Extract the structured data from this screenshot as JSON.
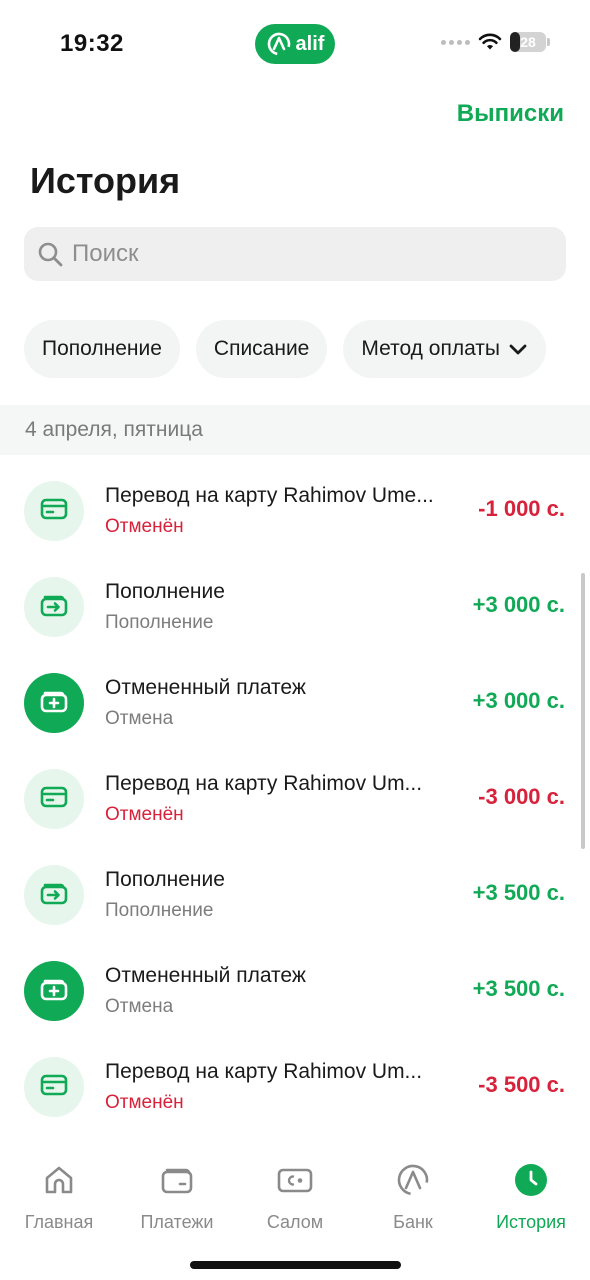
{
  "status_bar": {
    "time": "19:32",
    "brand": "alif",
    "battery": "28",
    "battery_level": 0.28
  },
  "header": {
    "statements_link": "Выписки",
    "title": "История"
  },
  "search": {
    "placeholder": "Поиск"
  },
  "filters": [
    {
      "label": "Пополнение"
    },
    {
      "label": "Списание"
    },
    {
      "label": "Метод оплаты"
    }
  ],
  "date_group": "4 апреля, пятница",
  "transactions": [
    {
      "title": "Перевод на карту Rahimov Ume...",
      "subtitle": "Отменён",
      "amount": "-1 000 с.",
      "icon": "card-icon"
    },
    {
      "title": "Пополнение",
      "subtitle": "Пополнение",
      "amount": "+3 000 с.",
      "icon": "wallet-in-icon"
    },
    {
      "title": "Отмененный платеж",
      "subtitle": "Отмена",
      "amount": "+3 000 с.",
      "icon": "wallet-plus-icon"
    },
    {
      "title": "Перевод на карту Rahimov Um...",
      "subtitle": "Отменён",
      "amount": "-3 000 с.",
      "icon": "card-icon"
    },
    {
      "title": "Пополнение",
      "subtitle": "Пополнение",
      "amount": "+3 500 с.",
      "icon": "wallet-in-icon"
    },
    {
      "title": "Отмененный платеж",
      "subtitle": "Отмена",
      "amount": "+3 500 с.",
      "icon": "wallet-plus-icon"
    },
    {
      "title": "Перевод на карту Rahimov Um...",
      "subtitle": "Отменён",
      "amount": "-3 500 с.",
      "icon": "card-icon"
    }
  ],
  "tabs": [
    {
      "label": "Главная",
      "icon": "home-icon"
    },
    {
      "label": "Платежи",
      "icon": "wallet-icon"
    },
    {
      "label": "Салом",
      "icon": "salom-icon"
    },
    {
      "label": "Банк",
      "icon": "alif-logo-icon"
    },
    {
      "label": "История",
      "icon": "clock-icon",
      "active": true
    }
  ],
  "colors": {
    "brand": "#10a955",
    "negative": "#d8223b",
    "secondary_text": "#7d7d7d"
  }
}
